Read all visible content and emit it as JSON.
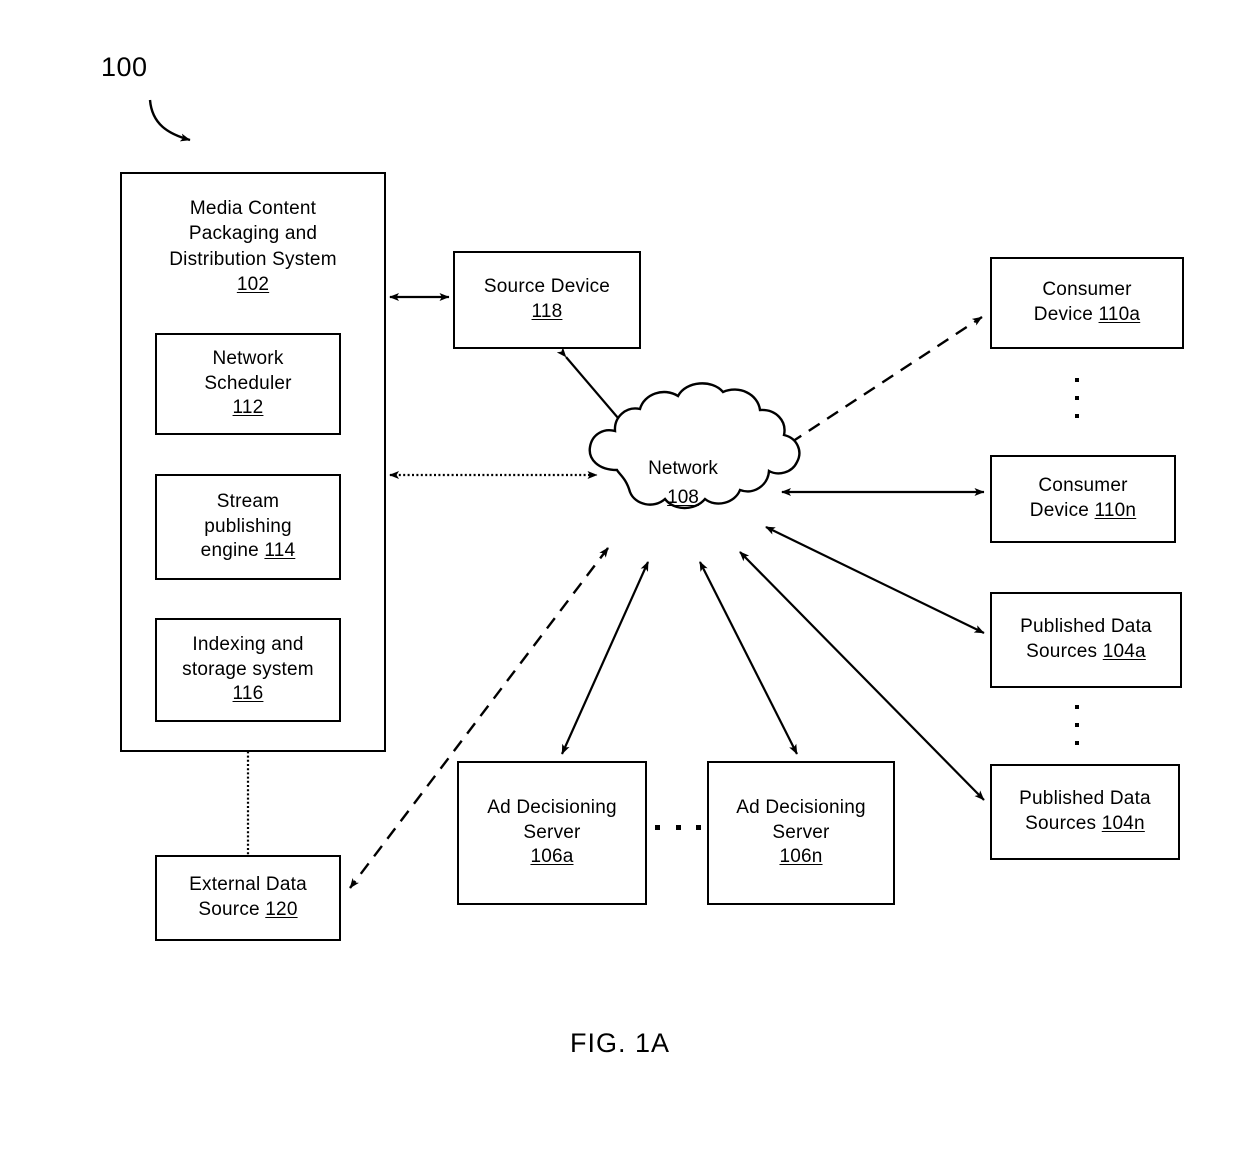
{
  "figure": {
    "caption": "FIG. 1A",
    "reference_tag": "100"
  },
  "blocks": {
    "system": {
      "title_line1": "Media Content",
      "title_line2": "Packaging and",
      "title_line3": "Distribution System",
      "ref": "102"
    },
    "scheduler": {
      "line1": "Network",
      "line2": "Scheduler",
      "ref": "112"
    },
    "stream": {
      "line1": "Stream",
      "line2": "publishing",
      "line3": "engine ",
      "ref": "114"
    },
    "indexing": {
      "line1": "Indexing and",
      "line2": "storage system",
      "ref": "116"
    },
    "external": {
      "line1": "External Data",
      "line2": "Source ",
      "ref": "120"
    },
    "source_device": {
      "line1": "Source Device",
      "ref": "118"
    },
    "network": {
      "line1": "Network",
      "ref": "108"
    },
    "consumer_a": {
      "line1": "Consumer",
      "line2": "Device ",
      "ref": "110a"
    },
    "consumer_n": {
      "line1": "Consumer",
      "line2": "Device ",
      "ref": "110n"
    },
    "published_a": {
      "line1": "Published Data",
      "line2": "Sources ",
      "ref": "104a"
    },
    "published_n": {
      "line1": "Published Data",
      "line2": "Sources ",
      "ref": "104n"
    },
    "ad_server_a": {
      "line1": "Ad Decisioning",
      "line2": "Server",
      "ref": "106a"
    },
    "ad_server_n": {
      "line1": "Ad Decisioning",
      "line2": "Server",
      "ref": "106n"
    }
  },
  "connections": [
    {
      "from": "system",
      "to": "source_device",
      "style": "solid",
      "arrows": "both"
    },
    {
      "from": "system",
      "to": "network",
      "style": "dotted",
      "arrows": "both"
    },
    {
      "from": "source_device",
      "to": "network",
      "style": "solid",
      "arrows": "both"
    },
    {
      "from": "network",
      "to": "consumer_a",
      "style": "dashed",
      "arrows": "both"
    },
    {
      "from": "network",
      "to": "consumer_n",
      "style": "solid",
      "arrows": "both"
    },
    {
      "from": "network",
      "to": "published_a",
      "style": "solid",
      "arrows": "both"
    },
    {
      "from": "network",
      "to": "published_n",
      "style": "solid",
      "arrows": "both"
    },
    {
      "from": "network",
      "to": "ad_server_a",
      "style": "solid",
      "arrows": "both"
    },
    {
      "from": "network",
      "to": "ad_server_n",
      "style": "solid",
      "arrows": "both"
    },
    {
      "from": "network",
      "to": "external",
      "style": "dashed",
      "arrows": "both"
    },
    {
      "from": "scheduler",
      "to": "stream",
      "style": "solid",
      "arrows": "none"
    },
    {
      "from": "stream",
      "to": "indexing",
      "style": "solid",
      "arrows": "none"
    },
    {
      "from": "indexing",
      "to": "external",
      "style": "dotted",
      "arrows": "none"
    }
  ],
  "colors": {
    "stroke": "#000000",
    "background": "#ffffff"
  }
}
